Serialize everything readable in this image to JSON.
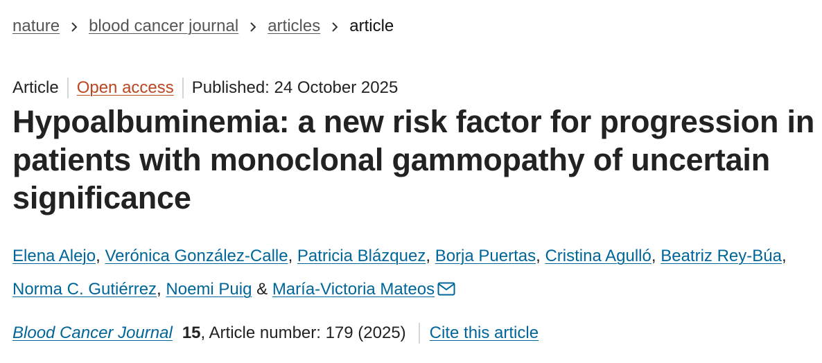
{
  "breadcrumb": {
    "items": [
      "nature",
      "blood cancer journal",
      "articles"
    ],
    "current": "article"
  },
  "meta": {
    "type": "Article",
    "access": "Open access",
    "published": "Published: 24 October 2025"
  },
  "title": "Hypoalbuminemia: a new risk factor for progression in patients with monoclonal gammopathy of uncertain significance",
  "authors": {
    "list": [
      "Elena Alejo",
      "Verónica González-Calle",
      "Patricia Blázquez",
      "Borja Puertas",
      "Cristina Agulló",
      "Beatriz Rey-Búa",
      "Norma C. Gutiérrez",
      "Noemi Puig",
      "María-Victoria Mateos"
    ],
    "comma": ",",
    "amp": "&"
  },
  "citation": {
    "journal": "Blood Cancer Journal",
    "volume": "15",
    "article_number": ", Article number: 179 (2025)",
    "cite_label": "Cite this article"
  },
  "colors": {
    "link": "#006699",
    "open_access": "#b9471f",
    "text": "#222222"
  }
}
